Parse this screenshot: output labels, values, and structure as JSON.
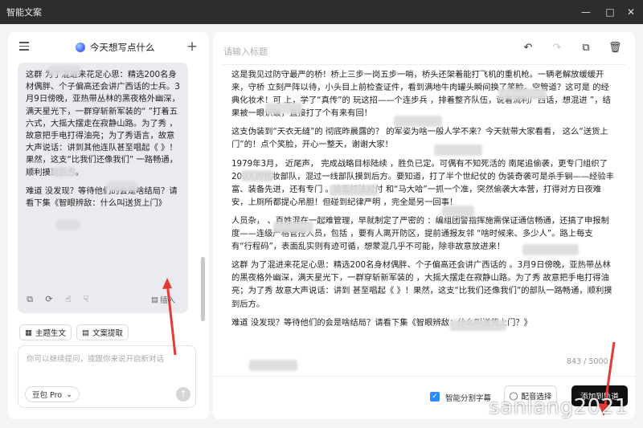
{
  "window": {
    "title": "智能文案",
    "controls": [
      "minimize-icon",
      "maximize-icon",
      "close-icon"
    ]
  },
  "left": {
    "title": "今天想写点什么",
    "message_paragraphs": [
      "这群    为了混进来花足心思：精选200名身材偶胖、个子偏高还会讲广西话的士兵。3月9日傍晚，亚热带丛林的黑夜格外幽深，满天星光下，一群穿斩新军装的“ ”打着五六式，大摇大摆走在寂静山路。为了秀 ，故意把手电打得油亮；为了秀语言，故意大声说话：讲到其他连队甚至唱起《 》！果然，这支“比我们还像我们” 一路畅通，顺利摸到后方。",
      "难道     没发现？等待他们的会是啥结局？请看下集《智眼辨敌：什么叫送货上门》"
    ],
    "insert_label": "插入",
    "chips": [
      {
        "label": "主题生文",
        "icon": "topic-icon"
      },
      {
        "label": "文案提取",
        "icon": "extract-icon"
      }
    ],
    "input_placeholder": "你可以继续提问，或跟你来说开启新对话",
    "model": "豆包 Pro"
  },
  "editor": {
    "title_placeholder": "请输入标题",
    "paragraphs": [
      "这是我见过防守最严的桥！桥上三步一岗五步一哨，桥头还架着能打飞机的重机枪。一辆老解放缓缓开来，守桥    立刻严阵以待，小头目上前检查证件，看到满地牛肉罐头瞬间换了笑脸。空管道？这可是      的经典化妆术！可      上，学了“真传”的        玩这招——个连步兵     ，排着整齐队伍，说着流利广西话，想混进         ”，结果被一眼识破，直接打了个有来有回！",
      "这支伪装到“天衣无缝”的   彻底昨晨露的？    的军姿为啥一般人学不来？今天就带大家看看，      这么“送货上门”的！点个笑脸，开心一整天，谢谢大家！",
      "1979年3月，     近尾声，     完成战略目标陆续     ，胜负已定。可偶有不知死活的     南尾追偷袭，更专门组织了200人的化妆部队，混过一线部队摸到后方。要知道，打了半个世纪仗的     伪装奇袭可是杀手锏——经验丰富、装备先进，还有专门     。这套打法对付     和“马大哈”一抓一个准，突然偷袭大本营，打得对方日夜难安，上厕所都提心吊胆！但碰到纪律严明      ，完全是另一回事！",
      "      人员杂，   、百姓混在一起难管理，早就制定了严密的         ：编组团警指挥施需保证通信畅通，还搞了申报制度——连级严格管控人员，包括    ，要有人离开防区，提前通报友邻      “啥时候来、多少人”。路上每支      有“行程码”，表面乱实则有迹可循，想蒙混几乎不可能，除非故意放进来！",
      "这群    为了混进来花足心思：精选200名身材偶胖、个子偏高还会讲广西话的      。3月9日傍晚，亚热带丛林的黑夜格外幽深，满天星光下，一群穿斩新军装的          ，大摇大摆走在寂静山路。为了秀     故意把手电打得油亮；为了秀       故意大声说话：讲到      甚至唱起《     》！果然，这支“比我们还像我们”的部队一路畅通，顺利摸到后方。",
      "难道      没发现？等待他们的会是啥结局？请看下集《智眼辨敌：什么叫送货上门？》"
    ],
    "char_count": "843 / 5000",
    "smart_split_label": "智能分割字幕",
    "voice_label": "配音选择",
    "add_track_label": "添加到轨道"
  },
  "watermark": "sanlang2021"
}
